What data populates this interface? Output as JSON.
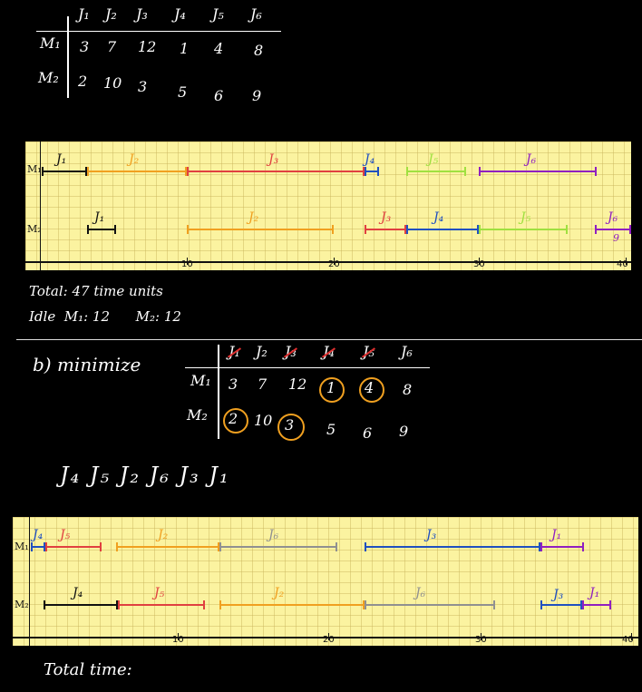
{
  "table1": {
    "jobs": [
      "J₁",
      "J₂",
      "J₃",
      "J₄",
      "J₅",
      "J₆"
    ],
    "rows": [
      {
        "machine": "M₁",
        "times": [
          "3",
          "7",
          "12",
          "1",
          "4",
          "8"
        ]
      },
      {
        "machine": "M₂",
        "times": [
          "2",
          "10",
          "3",
          "5",
          "6",
          "9"
        ]
      }
    ]
  },
  "gantt1": {
    "m1_label": "M₁",
    "m2_label": "M₂",
    "ticks": [
      "10",
      "20",
      "30",
      "40"
    ],
    "m1_jobs": [
      {
        "label": "J₁",
        "color": "#111111"
      },
      {
        "label": "J₂",
        "color": "#f0a020"
      },
      {
        "label": "J₃",
        "color": "#e04040"
      },
      {
        "label": "J₄",
        "color": "#2050c0"
      },
      {
        "label": "J₅",
        "color": "#a0e040"
      },
      {
        "label": "J₆",
        "color": "#9020c0"
      }
    ],
    "m2_jobs": [
      {
        "label": "J₁",
        "color": "#111111"
      },
      {
        "label": "J₂",
        "color": "#f0a020"
      },
      {
        "label": "J₃",
        "color": "#e04040"
      },
      {
        "label": "J₄",
        "color": "#2050c0"
      },
      {
        "label": "J₅",
        "color": "#a0e040"
      },
      {
        "label": "J₆",
        "color": "#9020c0"
      }
    ],
    "note": "9"
  },
  "summary": {
    "total": "Total: 47 time units",
    "idle": "Idle  M₁: 12      M₂: 12"
  },
  "part_b": {
    "title": "b) minimize",
    "jobs": [
      "J₁",
      "J₂",
      "J₃",
      "J₄",
      "J₅",
      "J₆"
    ],
    "rows": [
      {
        "machine": "M₁",
        "times": [
          "3",
          "7",
          "12",
          "1",
          "4",
          "8"
        ]
      },
      {
        "machine": "M₂",
        "times": [
          "2",
          "10",
          "3",
          "5",
          "6",
          "9"
        ]
      }
    ],
    "sequence": "J₄ J₅ J₂ J₆ J₃ J₁"
  },
  "gantt2": {
    "m1_label": "M₁",
    "m2_label": "M₂",
    "ticks": [
      "10",
      "20",
      "30",
      "40"
    ],
    "m1_jobs": [
      {
        "label": "J₄",
        "color": "#2050c0"
      },
      {
        "label": "J₅",
        "color": "#e04040"
      },
      {
        "label": "J₂",
        "color": "#f0a020"
      },
      {
        "label": "J₆",
        "color": "#909090"
      },
      {
        "label": "J₃",
        "color": "#2050c0"
      },
      {
        "label": "J₁",
        "color": "#9020c0"
      }
    ],
    "m2_jobs": [
      {
        "label": "J₄",
        "color": "#111111"
      },
      {
        "label": "J₅",
        "color": "#e04040"
      },
      {
        "label": "J₂",
        "color": "#f0a020"
      },
      {
        "label": "J₆",
        "color": "#909090"
      },
      {
        "label": "J₃",
        "color": "#2050c0"
      },
      {
        "label": "J₁",
        "color": "#9020c0"
      }
    ]
  },
  "footer": "Total time:"
}
